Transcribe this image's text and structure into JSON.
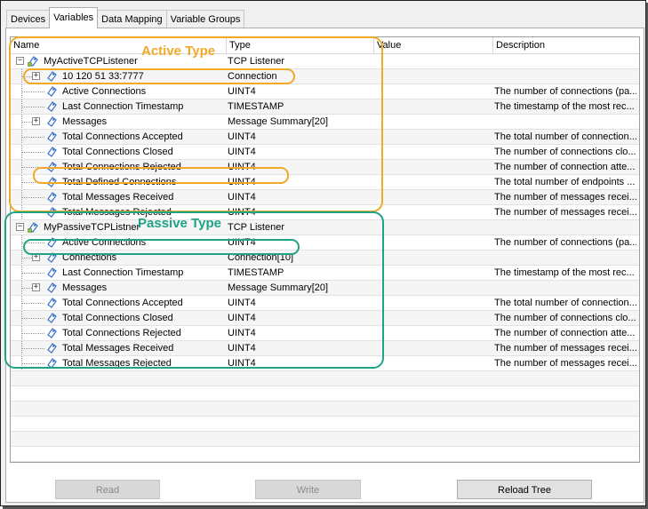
{
  "tabs": [
    "Devices",
    "Variables",
    "Data Mapping",
    "Variable Groups"
  ],
  "active_tab_index": 1,
  "columns": {
    "name": "Name",
    "type": "Type",
    "value": "Value",
    "description": "Description"
  },
  "rows": [
    {
      "name": "MyActiveTCPListener",
      "type": "TCP Listener",
      "value": "",
      "description": "",
      "level": 0,
      "expander": "-",
      "icon": "variable-root-icon"
    },
    {
      "name": "10 120 51 33:7777",
      "type": "Connection",
      "value": "",
      "description": "",
      "level": 1,
      "expander": "+",
      "icon": "variable-icon"
    },
    {
      "name": "Active Connections",
      "type": "UINT4",
      "value": "",
      "description": "The number of connections (pa...",
      "level": 1,
      "expander": "",
      "icon": "variable-icon"
    },
    {
      "name": "Last Connection Timestamp",
      "type": "TIMESTAMP",
      "value": "",
      "description": "The timestamp of the most rec...",
      "level": 1,
      "expander": "",
      "icon": "variable-icon"
    },
    {
      "name": "Messages",
      "type": "Message Summary[20]",
      "value": "",
      "description": "",
      "level": 1,
      "expander": "+",
      "icon": "variable-icon"
    },
    {
      "name": "Total Connections Accepted",
      "type": "UINT4",
      "value": "",
      "description": "The total number of connection...",
      "level": 1,
      "expander": "",
      "icon": "variable-icon"
    },
    {
      "name": "Total Connections Closed",
      "type": "UINT4",
      "value": "",
      "description": "The number of connections clo...",
      "level": 1,
      "expander": "",
      "icon": "variable-icon"
    },
    {
      "name": "Total Connections Rejected",
      "type": "UINT4",
      "value": "",
      "description": "The number of connection atte...",
      "level": 1,
      "expander": "",
      "icon": "variable-icon"
    },
    {
      "name": "Total Defined Connections",
      "type": "UINT4",
      "value": "",
      "description": "The total number of endpoints ...",
      "level": 1,
      "expander": "",
      "icon": "variable-icon"
    },
    {
      "name": "Total Messages Received",
      "type": "UINT4",
      "value": "",
      "description": "The number of messages recei...",
      "level": 1,
      "expander": "",
      "icon": "variable-icon"
    },
    {
      "name": "Total Messages Rejected",
      "type": "UINT4",
      "value": "",
      "description": "The number of messages recei...",
      "level": 1,
      "expander": "",
      "icon": "variable-icon"
    },
    {
      "name": "MyPassiveTCPListner",
      "type": "TCP Listener",
      "value": "",
      "description": "",
      "level": 0,
      "expander": "-",
      "icon": "variable-root-icon"
    },
    {
      "name": "Active Connections",
      "type": "UINT4",
      "value": "",
      "description": "The number of connections (pa...",
      "level": 1,
      "expander": "",
      "icon": "variable-icon"
    },
    {
      "name": "Connections",
      "type": "Connection[10]",
      "value": "",
      "description": "",
      "level": 1,
      "expander": "+",
      "icon": "variable-icon"
    },
    {
      "name": "Last Connection Timestamp",
      "type": "TIMESTAMP",
      "value": "",
      "description": "The timestamp of the most rec...",
      "level": 1,
      "expander": "",
      "icon": "variable-icon"
    },
    {
      "name": "Messages",
      "type": "Message Summary[20]",
      "value": "",
      "description": "",
      "level": 1,
      "expander": "+",
      "icon": "variable-icon"
    },
    {
      "name": "Total Connections Accepted",
      "type": "UINT4",
      "value": "",
      "description": "The total number of connection...",
      "level": 1,
      "expander": "",
      "icon": "variable-icon"
    },
    {
      "name": "Total Connections Closed",
      "type": "UINT4",
      "value": "",
      "description": "The number of connections clo...",
      "level": 1,
      "expander": "",
      "icon": "variable-icon"
    },
    {
      "name": "Total Connections Rejected",
      "type": "UINT4",
      "value": "",
      "description": "The number of connection atte...",
      "level": 1,
      "expander": "",
      "icon": "variable-icon"
    },
    {
      "name": "Total Messages Received",
      "type": "UINT4",
      "value": "",
      "description": "The number of messages recei...",
      "level": 1,
      "expander": "",
      "icon": "variable-icon"
    },
    {
      "name": "Total Messages Rejected",
      "type": "UINT4",
      "value": "",
      "description": "The number of messages recei...",
      "level": 1,
      "expander": "",
      "icon": "variable-icon"
    }
  ],
  "annotations": {
    "active": {
      "label": "Active Type",
      "color": "#f0a92a"
    },
    "passive": {
      "label": "Passive Type",
      "color": "#1fa385"
    }
  },
  "buttons": {
    "read": "Read",
    "write": "Write",
    "reload": "Reload Tree"
  },
  "colors": {
    "active_annotation": "#f0a92a",
    "passive_annotation": "#1fa385",
    "icon_blue": "#3a73c9"
  }
}
